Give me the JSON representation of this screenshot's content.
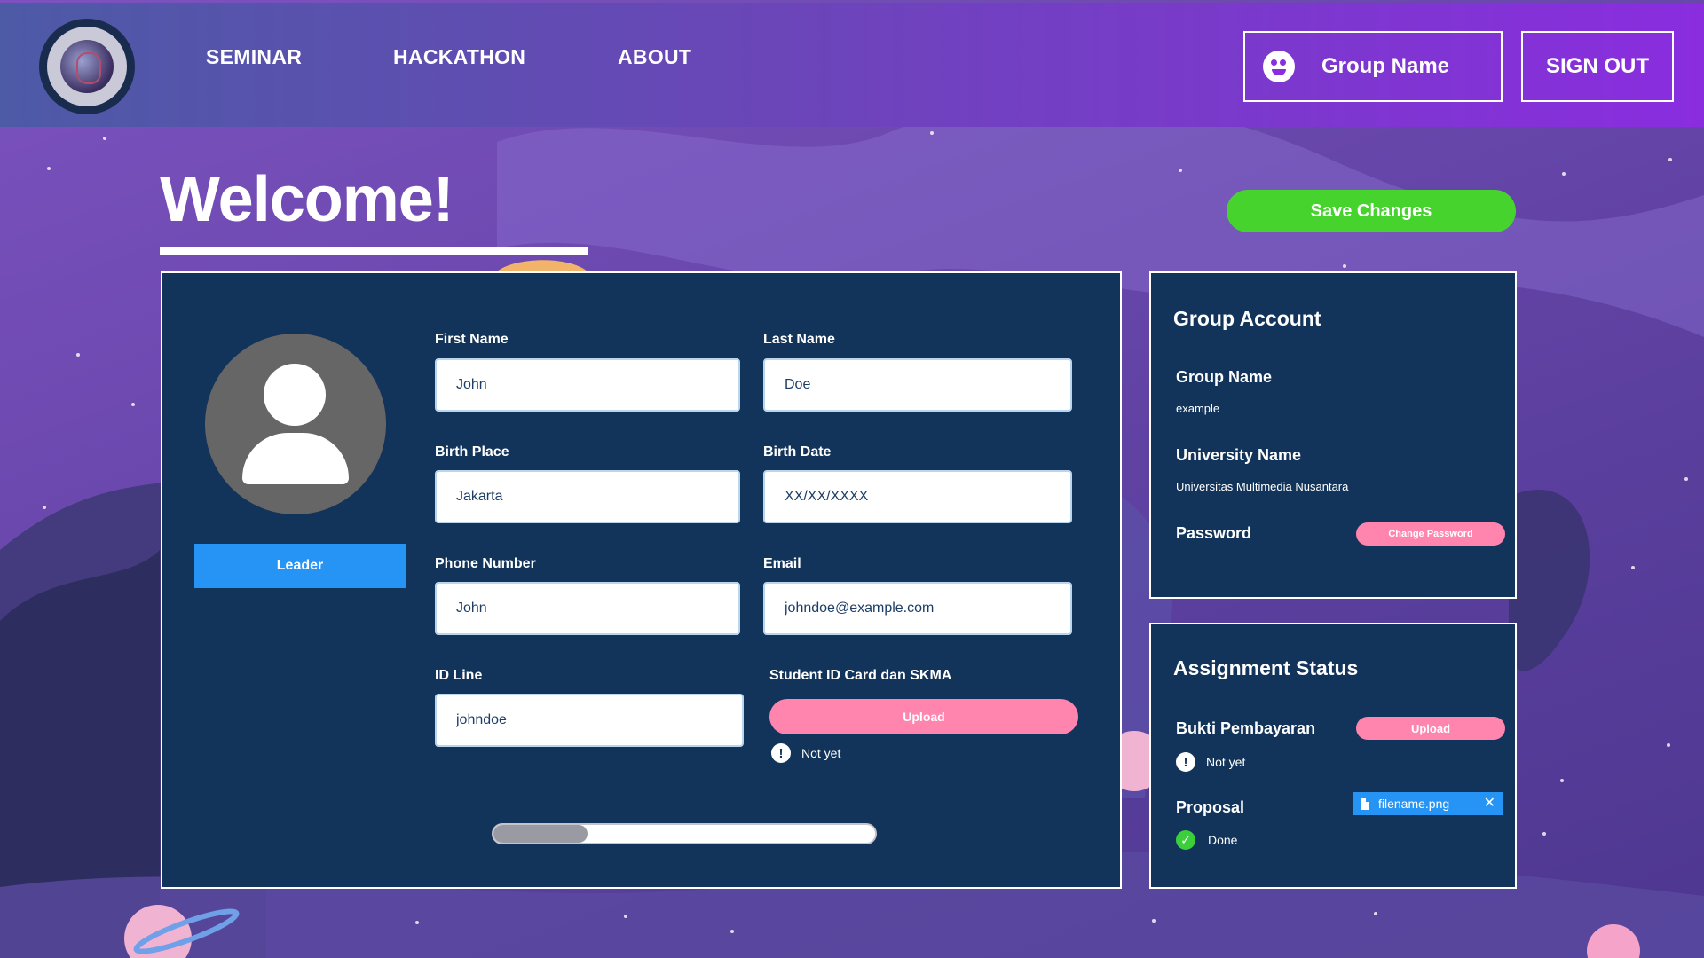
{
  "nav": {
    "links": [
      "SEMINAR",
      "HACKATHON",
      "ABOUT"
    ],
    "group_button": "Group Name",
    "signout": "SIGN OUT"
  },
  "header": {
    "welcome": "Welcome!",
    "save_changes": "Save Changes"
  },
  "profile": {
    "role": "Leader",
    "fields": {
      "first_name": {
        "label": "First Name",
        "value": "John"
      },
      "last_name": {
        "label": "Last Name",
        "value": "Doe"
      },
      "birth_place": {
        "label": "Birth Place",
        "value": "Jakarta"
      },
      "birth_date": {
        "label": "Birth Date",
        "value": "XX/XX/XXXX"
      },
      "phone": {
        "label": "Phone Number",
        "value": "John"
      },
      "email": {
        "label": "Email",
        "value": "johndoe@example.com"
      },
      "id_line": {
        "label": "ID Line",
        "value": "johndoe"
      }
    },
    "student_id": {
      "label": "Student ID Card dan SKMA",
      "upload": "Upload",
      "status": "Not yet",
      "status_icon": "exclamation-icon"
    },
    "scroll_position": 0.25
  },
  "group_account": {
    "title": "Group Account",
    "group_name_label": "Group Name",
    "group_name": "example",
    "university_label": "University Name",
    "university": "Universitas Multimedia Nusantara",
    "password_label": "Password",
    "change_password": "Change Password"
  },
  "assignment": {
    "title": "Assignment Status",
    "payment_label": "Bukti Pembayaran",
    "payment_upload": "Upload",
    "payment_status": "Not yet",
    "proposal_label": "Proposal",
    "proposal_file": "filename.png",
    "proposal_status": "Done"
  },
  "colors": {
    "navbar_start": "#4d5aa6",
    "navbar_end": "#8a2ddf",
    "panel": "#13345a",
    "save_green": "#47d32e",
    "upload_pink": "#ff84ae",
    "leader_blue": "#2694f5",
    "done_green": "#3bcf3b"
  }
}
